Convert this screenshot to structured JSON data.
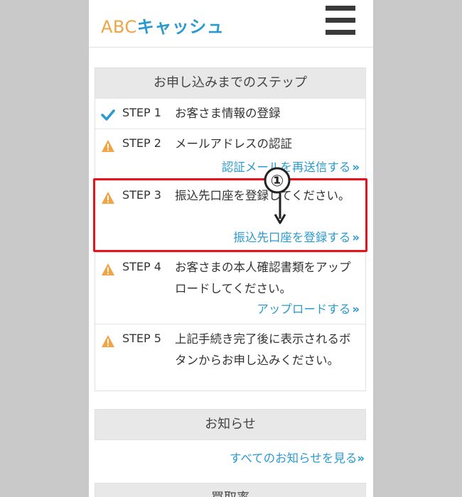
{
  "header": {
    "logo_abc": "ABC",
    "logo_kana": "キャッシュ"
  },
  "steps_panel": {
    "title": "お申し込みまでのステップ",
    "steps": [
      {
        "label": "STEP 1",
        "text": "お客さま情報の登録",
        "status": "complete"
      },
      {
        "label": "STEP 2",
        "text": "メールアドレスの認証",
        "link": "認証メールを再送信する",
        "status": "warning"
      },
      {
        "label": "STEP 3",
        "text": "振込先口座を登録してください。",
        "link": "振込先口座を登録する",
        "status": "warning"
      },
      {
        "label": "STEP 4",
        "text": "お客さまの本人確認書類をアップロードしてください。",
        "link": "アップロードする",
        "status": "warning"
      },
      {
        "label": "STEP 5",
        "text": "上記手続き完了後に表示されるボタンからお申し込みください。",
        "status": "warning"
      }
    ]
  },
  "notice_panel": {
    "title": "お知らせ",
    "link": "すべてのお知らせを見る"
  },
  "next_panel": {
    "title": "買取率"
  },
  "annotation": {
    "badge": "①"
  },
  "colors": {
    "accent_blue": "#2a9bd0",
    "warning_orange": "#f0a545",
    "highlight_red": "#e8141c"
  }
}
